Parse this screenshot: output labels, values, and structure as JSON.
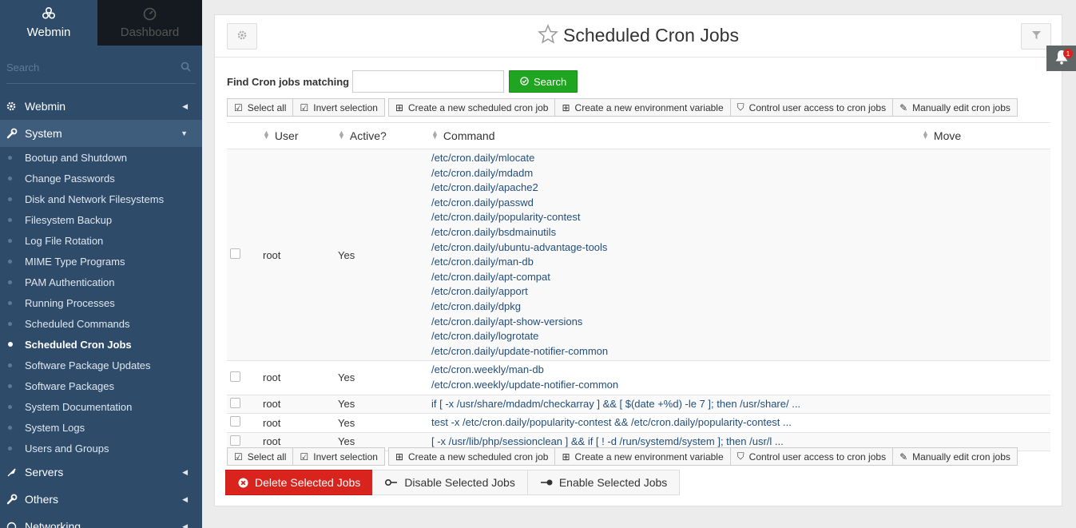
{
  "sidebar": {
    "tabs": [
      {
        "label": "Webmin",
        "icon": "webmin-logo-icon",
        "active": true
      },
      {
        "label": "Dashboard",
        "icon": "dashboard-icon",
        "active": false
      }
    ],
    "search_placeholder": "Search",
    "categories": {
      "webmin": "Webmin",
      "system": "System",
      "servers": "Servers",
      "others": "Others",
      "networking": "Networking"
    },
    "system_items": [
      "Bootup and Shutdown",
      "Change Passwords",
      "Disk and Network Filesystems",
      "Filesystem Backup",
      "Log File Rotation",
      "MIME Type Programs",
      "PAM Authentication",
      "Running Processes",
      "Scheduled Commands",
      "Scheduled Cron Jobs",
      "Software Package Updates",
      "Software Packages",
      "System Documentation",
      "System Logs",
      "Users and Groups"
    ],
    "active_item": "Scheduled Cron Jobs"
  },
  "main": {
    "title": "Scheduled Cron Jobs",
    "find_label": "Find Cron jobs matching",
    "find_value": "",
    "search_button": "Search",
    "toolbar": {
      "select_all": "Select all",
      "invert_selection": "Invert selection",
      "create_job": "Create a new scheduled cron job",
      "create_env": "Create a new environment variable",
      "control_access": "Control user access to cron jobs",
      "manual_edit": "Manually edit cron jobs"
    },
    "columns": {
      "user": "User",
      "active": "Active?",
      "command": "Command",
      "move": "Move"
    },
    "rows": [
      {
        "user": "root",
        "active": "Yes",
        "commands": [
          "/etc/cron.daily/mlocate",
          "/etc/cron.daily/mdadm",
          "/etc/cron.daily/apache2",
          "/etc/cron.daily/passwd",
          "/etc/cron.daily/popularity-contest",
          "/etc/cron.daily/bsdmainutils",
          "/etc/cron.daily/ubuntu-advantage-tools",
          "/etc/cron.daily/man-db",
          "/etc/cron.daily/apt-compat",
          "/etc/cron.daily/apport",
          "/etc/cron.daily/dpkg",
          "/etc/cron.daily/apt-show-versions",
          "/etc/cron.daily/logrotate",
          "/etc/cron.daily/update-notifier-common"
        ]
      },
      {
        "user": "root",
        "active": "Yes",
        "commands": [
          "/etc/cron.weekly/man-db",
          "/etc/cron.weekly/update-notifier-common"
        ]
      },
      {
        "user": "root",
        "active": "Yes",
        "commands": [
          "if [ -x /usr/share/mdadm/checkarray ] && [ $(date +%d) -le 7 ]; then /usr/share/ ..."
        ]
      },
      {
        "user": "root",
        "active": "Yes",
        "commands": [
          "test -x /etc/cron.daily/popularity-contest && /etc/cron.daily/popularity-contest ..."
        ]
      },
      {
        "user": "root",
        "active": "Yes",
        "commands": [
          "[ -x /usr/lib/php/sessionclean ] && if [ ! -d /run/systemd/system ]; then /usr/l ..."
        ]
      }
    ],
    "actions": {
      "delete": "Delete Selected Jobs",
      "disable": "Disable Selected Jobs",
      "enable": "Enable Selected Jobs"
    }
  },
  "notifications": {
    "count": "1"
  },
  "colors": {
    "sidebar_bg": "#2e4b6a",
    "sidebar_open_bg": "#3e5c7c",
    "search_green": "#1fa51f",
    "delete_red": "#d9231d",
    "link_blue": "#234e7a"
  }
}
